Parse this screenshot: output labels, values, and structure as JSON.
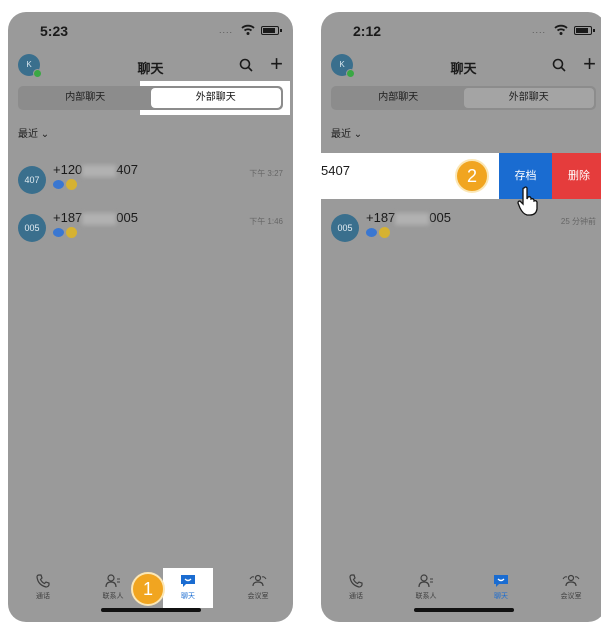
{
  "left_phone": {
    "status_time": "5:23",
    "status_dots": "....",
    "avatar_letter": "K",
    "title": "聊天",
    "tabs": [
      "内部聊天",
      "外部聊天"
    ],
    "filter_label": "最近 ⌄",
    "chats": [
      {
        "avatar": "407",
        "name_prefix": "+120",
        "name_suffix": "407",
        "time": "下午 3:27"
      },
      {
        "avatar": "005",
        "name_prefix": "+187",
        "name_suffix": "005",
        "time": "下午 1:46"
      }
    ],
    "bottom_tabs": [
      "通话",
      "联系人",
      "聊天",
      "会议室"
    ],
    "step": "1"
  },
  "right_phone": {
    "status_time": "2:12",
    "status_dots": "....",
    "avatar_letter": "K",
    "title": "聊天",
    "tabs": [
      "内部聊天",
      "外部聊天"
    ],
    "filter_label": "最近 ⌄",
    "swiped_name": "5407",
    "archive_label": "存档",
    "delete_label": "删除",
    "chats": [
      {
        "avatar": "005",
        "name_prefix": "+187",
        "name_suffix": "005",
        "time": "25 分钟前"
      }
    ],
    "bottom_tabs": [
      "通话",
      "联系人",
      "聊天",
      "会议室"
    ],
    "step": "2"
  },
  "colors": {
    "overlay_gray": "#9a9a9a",
    "accent_blue": "#1a6cd1",
    "delete_red": "#e53c3c",
    "step_orange": "#f1a520"
  },
  "icons": [
    "wifi-icon",
    "battery-icon",
    "search-icon",
    "plus-icon",
    "phone-icon",
    "contacts-icon",
    "chat-icon",
    "meeting-icon",
    "hand-pointer-icon"
  ]
}
